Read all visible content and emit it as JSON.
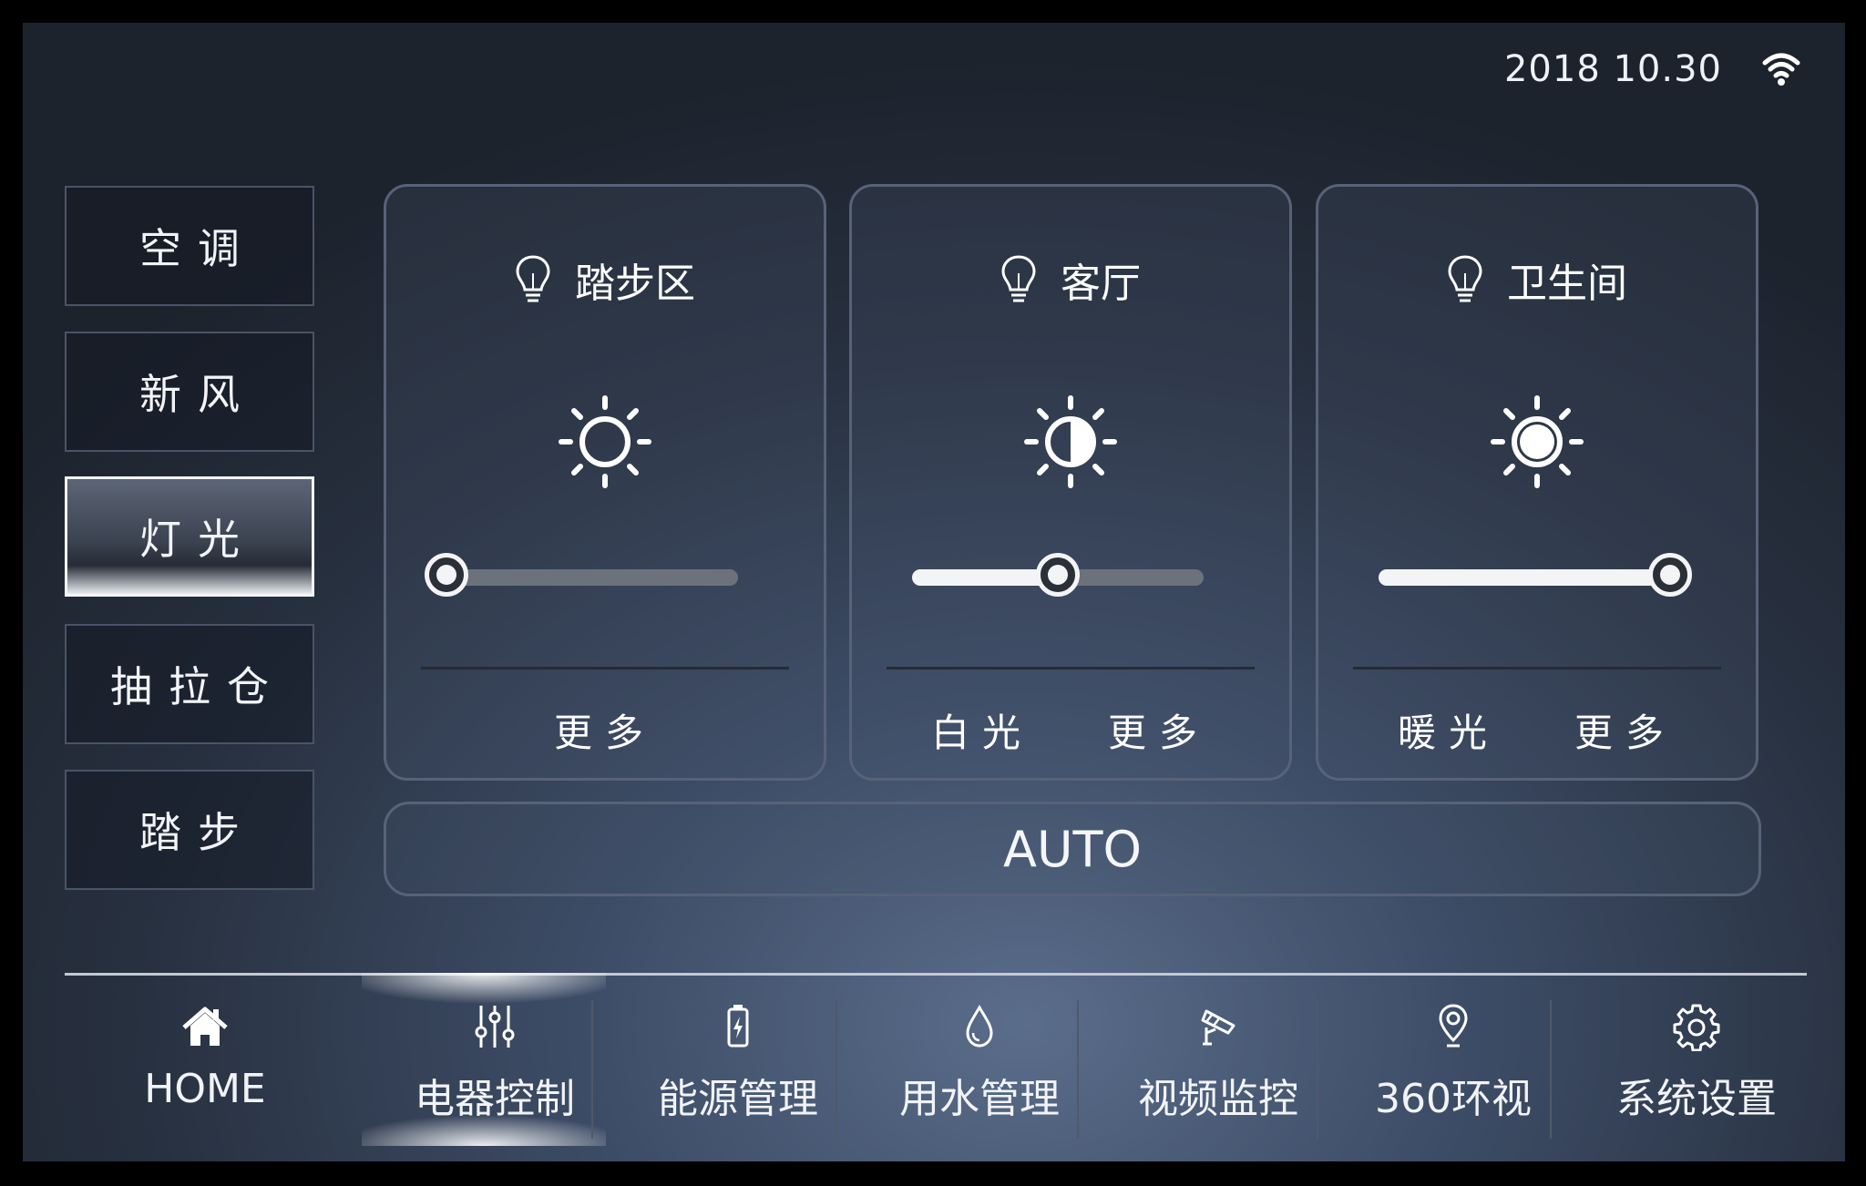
{
  "status": {
    "date": "2018 10.30",
    "wifi_icon": "wifi-icon"
  },
  "sidebar": {
    "items": [
      {
        "label": "空调",
        "active": false
      },
      {
        "label": "新风",
        "active": false
      },
      {
        "label": "灯光",
        "active": true
      },
      {
        "label": "抽拉仓",
        "active": false
      },
      {
        "label": "踏步",
        "active": false
      }
    ]
  },
  "cards": [
    {
      "title": "踏步区",
      "icon": "lightbulb-icon",
      "brightness_icon": "brightness-low-icon",
      "level": 0.0,
      "actions": [
        "更多"
      ]
    },
    {
      "title": "客厅",
      "icon": "lightbulb-icon",
      "brightness_icon": "brightness-half-icon",
      "level": 0.5,
      "actions": [
        "白光",
        "更多"
      ]
    },
    {
      "title": "卫生间",
      "icon": "lightbulb-icon",
      "brightness_icon": "brightness-high-icon",
      "level": 1.0,
      "actions": [
        "暖光",
        "更多"
      ]
    }
  ],
  "auto_label": "AUTO",
  "nav": {
    "items": [
      {
        "label": "HOME",
        "icon": "home-icon",
        "active": false
      },
      {
        "label": "电器控制",
        "icon": "sliders-icon",
        "active": true
      },
      {
        "label": "能源管理",
        "icon": "battery-icon",
        "active": false
      },
      {
        "label": "用水管理",
        "icon": "water-drop-icon",
        "active": false
      },
      {
        "label": "视频监控",
        "icon": "camera-icon",
        "active": false
      },
      {
        "label": "360环视",
        "icon": "location-pin-icon",
        "active": false
      },
      {
        "label": "系统设置",
        "icon": "gear-icon",
        "active": false
      }
    ]
  },
  "colors": {
    "accent": "#f3f4f6",
    "track": "#6b727c",
    "card_border": "#586278"
  }
}
